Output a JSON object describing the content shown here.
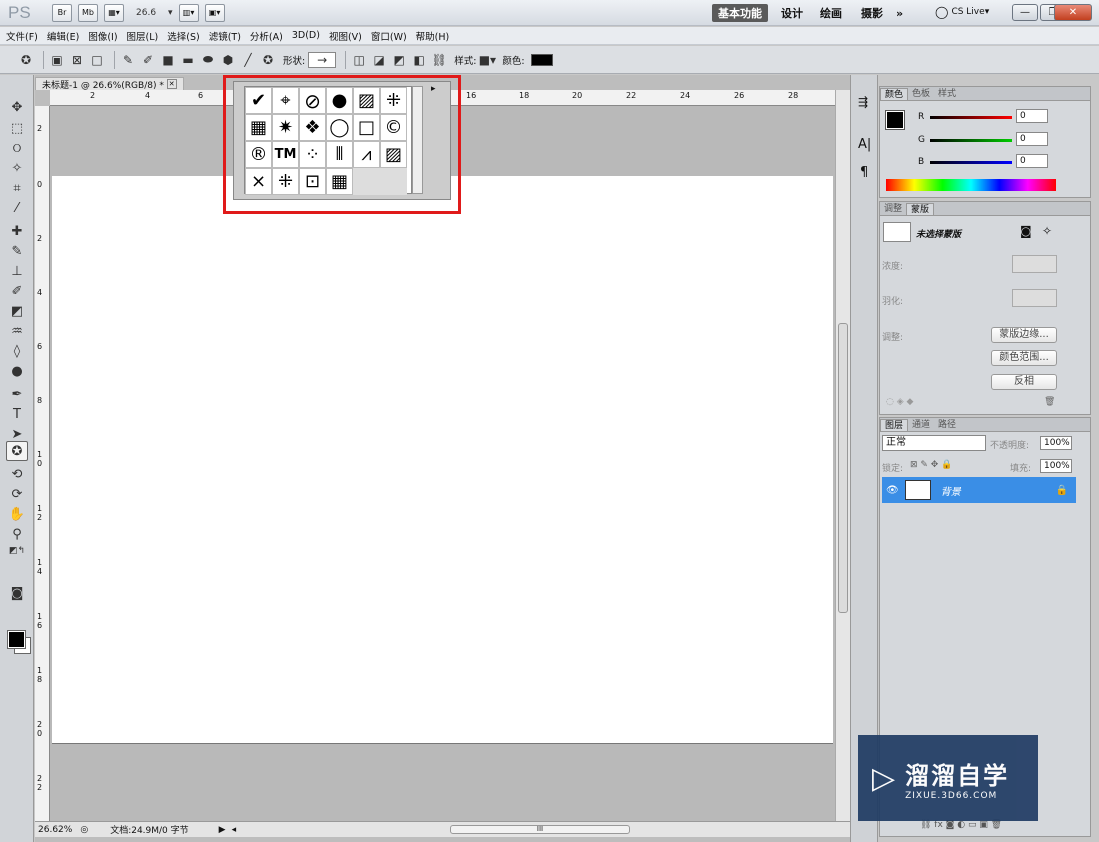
{
  "app": {
    "logo": "PS",
    "br": "Br",
    "mb": "Mb",
    "zoom": "26.6",
    "zoom_caret": "▾"
  },
  "workspaces": [
    {
      "label": "基本功能",
      "active": true
    },
    {
      "label": "设计"
    },
    {
      "label": "绘画"
    },
    {
      "label": "摄影"
    },
    {
      "label": "»"
    }
  ],
  "cslive": "CS Live",
  "window_controls": {
    "min": "—",
    "max": "❐",
    "close": "✕"
  },
  "menu": [
    "文件(F)",
    "编辑(E)",
    "图像(I)",
    "图层(L)",
    "选择(S)",
    "滤镜(T)",
    "分析(A)",
    "3D(D)",
    "视图(V)",
    "窗口(W)",
    "帮助(H)"
  ],
  "options": {
    "shape_label": "形状:",
    "shape_value": "→",
    "style_label": "样式:",
    "color_label": "颜色:",
    "color": "#000000"
  },
  "document": {
    "tab": "未标题-1 @ 26.6%(RGB/8) *",
    "close": "✕",
    "ruler_h": [
      "2",
      "4",
      "6",
      "16",
      "18",
      "20",
      "22",
      "24",
      "26",
      "28"
    ],
    "ruler_v": [
      "2",
      "0",
      "2",
      "4",
      "6",
      "8",
      "1 0",
      "1 2",
      "1 4",
      "1 6",
      "1 8",
      "2 0",
      "2 2"
    ],
    "status_zoom": "26.62%",
    "status_doc": "文档:24.9M/0 字节",
    "hscroll_label": "III"
  },
  "shapes_popup": {
    "cells": [
      "✔",
      "⌖",
      "⃠",
      "💬",
      "▨",
      "⁜",
      "▦",
      "✷",
      "🐾",
      "◯",
      "□",
      "©",
      "®",
      "TM",
      "⁘",
      "⦀",
      "⩘",
      "▨",
      "⨯",
      "⁜",
      "⊡",
      "▦",
      "",
      ""
    ],
    "menu_icon": "▸"
  },
  "color_panel": {
    "tabs": [
      "颜色",
      "色板",
      "样式"
    ],
    "r_label": "R",
    "g_label": "G",
    "b_label": "B",
    "r": "0",
    "g": "0",
    "b": "0"
  },
  "masks_panel": {
    "tabs": [
      "调整",
      "蒙版"
    ],
    "no_mask": "未选择蒙版",
    "density": "浓度:",
    "feather": "羽化:",
    "refine": "调整:",
    "btn_edge": "蒙版边缘...",
    "btn_range": "颜色范围...",
    "btn_invert": "反相"
  },
  "layers_panel": {
    "tabs": [
      "图层",
      "通道",
      "路径"
    ],
    "blend": "正常",
    "opacity_label": "不透明度:",
    "opacity": "100%",
    "lock_label": "锁定:",
    "fill_label": "填充:",
    "fill": "100%",
    "layer_name": "背景"
  },
  "watermark": {
    "title": "溜溜自学",
    "sub": "ZIXUE.3D66.COM"
  }
}
